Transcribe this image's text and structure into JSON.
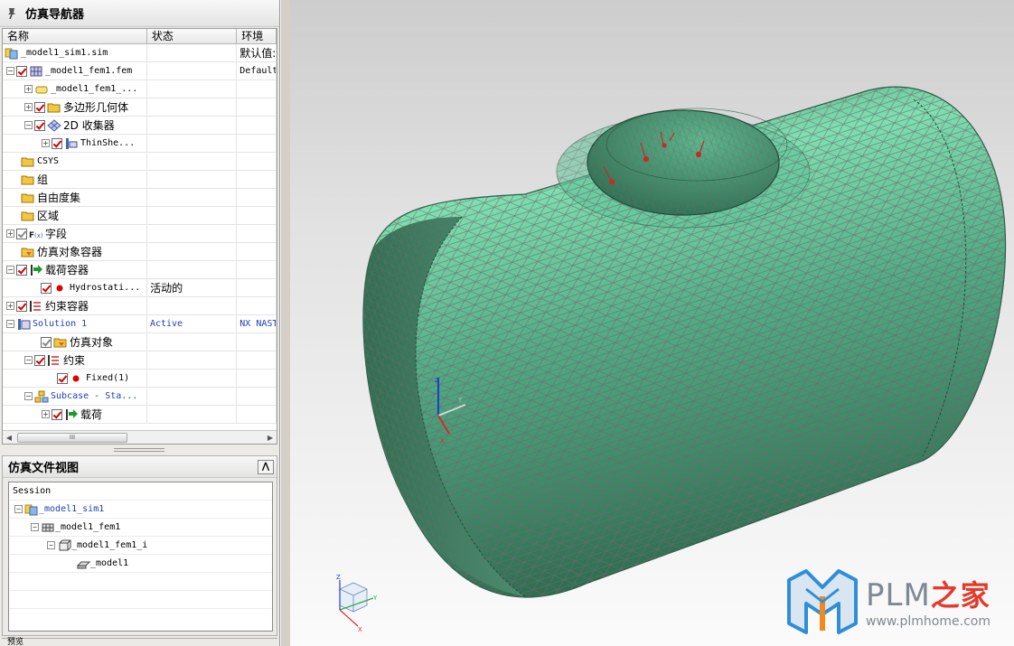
{
  "navigator": {
    "title": "仿真导航器",
    "columns": [
      "名称",
      "状态",
      "环境"
    ],
    "rows": [
      {
        "label": "_model1_sim1.sim",
        "status": "",
        "env": "默认值:",
        "mono": true
      },
      {
        "label": "_model1_fem1.fem",
        "status": "",
        "env": "Default",
        "mono": true
      },
      {
        "label": "_model1_fem1_...",
        "status": "",
        "env": "",
        "mono": true
      },
      {
        "label": "多边形几何体",
        "status": "",
        "env": ""
      },
      {
        "label": "2D 收集器",
        "status": "",
        "env": ""
      },
      {
        "label": "ThinShe...",
        "status": "",
        "env": "",
        "mono": true
      },
      {
        "label": "CSYS",
        "status": "",
        "env": ""
      },
      {
        "label": "组",
        "status": "",
        "env": ""
      },
      {
        "label": "自由度集",
        "status": "",
        "env": ""
      },
      {
        "label": "区域",
        "status": "",
        "env": ""
      },
      {
        "label": "字段",
        "status": "",
        "env": ""
      },
      {
        "label": "仿真对象容器",
        "status": "",
        "env": ""
      },
      {
        "label": "载荷容器",
        "status": "",
        "env": ""
      },
      {
        "label": "Hydrostati...",
        "status": "活动的",
        "env": "",
        "mono": true
      },
      {
        "label": "约束容器",
        "status": "",
        "env": ""
      },
      {
        "label": "Solution 1",
        "status": "Active",
        "env": "NX NAST",
        "mono": true
      },
      {
        "label": "仿真对象",
        "status": "",
        "env": ""
      },
      {
        "label": "约束",
        "status": "",
        "env": ""
      },
      {
        "label": "Fixed(1)",
        "status": "",
        "env": "",
        "mono": true
      },
      {
        "label": "Subcase - Sta...",
        "status": "",
        "env": "",
        "mono": true
      },
      {
        "label": "载荷",
        "status": "",
        "env": ""
      }
    ],
    "scroll_arrows": [
      "◀",
      "▶"
    ],
    "scroll_grip": "III"
  },
  "file_view": {
    "title": "仿真文件视图",
    "collapse": "⋀",
    "items": [
      {
        "label": "Session"
      },
      {
        "label": "_model1_sim1"
      },
      {
        "label": "_model1_fem1"
      },
      {
        "label": "_model1_fem1_i"
      },
      {
        "label": "_model1"
      }
    ]
  },
  "bottom_panel_title": "预览",
  "viewport": {
    "triad_labels": [
      "Z",
      "Y",
      "X"
    ],
    "watermark": {
      "brand": "PLM",
      "brand_cn": "之家",
      "url": "www.plmhome.com"
    },
    "colors": {
      "mesh": "#4e9a78",
      "mesh_line": "#6b6b73",
      "accent": "#e43a2a"
    }
  }
}
